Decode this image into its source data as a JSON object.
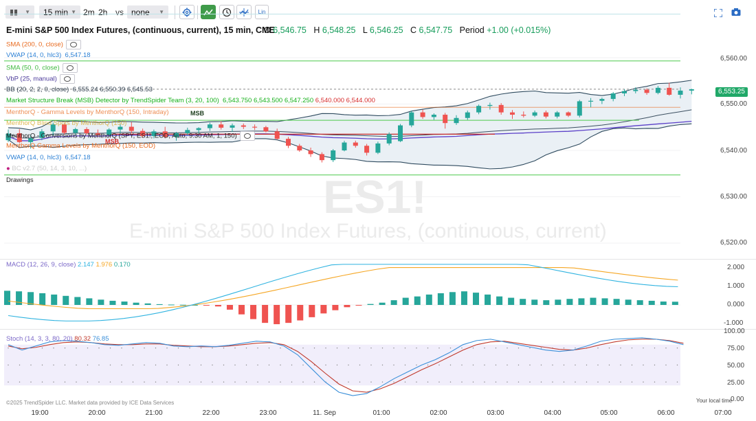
{
  "toolbar": {
    "chart_type_icon": "candles-icon",
    "interval": "15 min",
    "range_2m": "2m",
    "range_2h": "2h",
    "vs_label": "vs",
    "compare": "none",
    "settings_icon": "gear-icon",
    "crosshair_icon": "draw-cursor-icon",
    "clock_icon": "clock-icon",
    "trend_icon": "trendline-icon",
    "scale_label": "Lin",
    "fullscreen_icon": "fullscreen-icon",
    "camera_icon": "camera-icon"
  },
  "header": {
    "title": "E-mini S&P 500 Index Futures, (continuous, current), 15 min, CME",
    "o_label": "O",
    "o_value": "6,546.75",
    "h_label": "H",
    "h_value": "6,548.25",
    "l_label": "L",
    "l_value": "6,546.25",
    "c_label": "C",
    "c_value": "6,547.75",
    "period_label": "Period",
    "period_value": "+1.00 (+0.015%)"
  },
  "indicators": [
    {
      "label": "SMA (200, 0, close)",
      "color": "#e8691d"
    },
    {
      "label": "VWAP (14, 0, hlc3)",
      "color": "#2a7fd4",
      "value": "6,547.18"
    },
    {
      "label": "SMA (50, 0, close)",
      "color": "#3cb83c"
    },
    {
      "label": "VbP (25, manual)",
      "color": "#4b3a9a"
    },
    {
      "label": "BB (20, 2, 2, 0, close)",
      "color": "#2e3d4c",
      "values": "6,555.24  6,550.39  6,545.53"
    },
    {
      "label": "Market Structure Break (MSB) Detector by TrendSpider Team (3, 20, 100)",
      "color": "#15b01a",
      "values_green": "6,543.750  6,543.500  6,547.250",
      "values_red": "6,540.000  6,544.000"
    },
    {
      "label": "MenthorQ - Gamma Levels by MenthorQ (150, Intraday)",
      "color": "#e8691d"
    },
    {
      "label": "MenthorQ Blind Spots by MenthorQ (150)",
      "color": "#d4a017"
    },
    {
      "label": "MenthorQ - Conversions by MenthorQ (SPY, ES1!, EOD, Auto, 9:30 AM, 1, 150)",
      "color": "#222222"
    },
    {
      "label": "MenthorQ Gamma Levels by MenthorQ (150, EOD)",
      "color": "#e8691d"
    },
    {
      "label": "VWAP (14, 0, hlc3)",
      "color": "#2a7fd4",
      "value": "6,547.18"
    },
    {
      "label": "BC v2.7 (50, 14, 3, 10, ...)",
      "color": "#ccc"
    },
    {
      "label": "Drawings",
      "color": "#222222"
    }
  ],
  "price_axis": [
    "6,560.00",
    "6,550.00",
    "6,540.00",
    "6,530.00",
    "6,520.00"
  ],
  "last_price": "6,553.25",
  "watermark": {
    "symbol": "ES1!",
    "name": "E-mini S&P 500 Index Futures, (continuous, current)"
  },
  "msb_labels": [
    "MSB",
    "MSB"
  ],
  "macd": {
    "label": "MACD (12, 26, 9, close)",
    "v1": "2.147",
    "v2": "1.976",
    "v3": "0.170",
    "axis": [
      "2.000",
      "1.000",
      "0.000",
      "-1.000"
    ]
  },
  "stoch": {
    "label": "Stoch (14, 3, 3, 80, 20)",
    "v1": "80.32",
    "v2": "76.85",
    "axis": [
      "100.00",
      "75.00",
      "50.00",
      "25.00",
      "0.00"
    ]
  },
  "time_axis": [
    "19:00",
    "20:00",
    "21:00",
    "22:00",
    "23:00",
    "11. Sep",
    "01:00",
    "02:00",
    "03:00",
    "04:00",
    "05:00",
    "06:00",
    "07:00"
  ],
  "footer": {
    "copyright": "©2025 TrendSpider LLC. Market data provided by ICE Data Services",
    "local_time": "Your local time"
  },
  "colors": {
    "up": "#26a69a",
    "down": "#ef5350",
    "bb": "#2e4a5e",
    "macd": "#2fb3e0",
    "signal": "#f5a623",
    "stoch_k": "#3a8fd9",
    "stoch_d": "#c0392b"
  },
  "chart_data": {
    "type": "candlestick",
    "candles": [
      [
        6542.2,
        6544.5,
        6541.8,
        6543.6
      ],
      [
        6543.7,
        6544.6,
        6541.6,
        6541.8
      ],
      [
        6541.8,
        6543.4,
        6540.4,
        6542.6
      ],
      [
        6542.7,
        6544.6,
        6542.2,
        6544.1
      ],
      [
        6544.1,
        6546.0,
        6543.2,
        6545.6
      ],
      [
        6545.6,
        6545.9,
        6543.5,
        6543.8
      ],
      [
        6543.8,
        6544.9,
        6543.3,
        6544.6
      ],
      [
        6544.6,
        6545.0,
        6543.3,
        6543.7
      ],
      [
        6543.7,
        6544.5,
        6542.9,
        6543.3
      ],
      [
        6543.3,
        6544.8,
        6542.9,
        6544.5
      ],
      [
        6544.5,
        6545.7,
        6543.7,
        6545.1
      ],
      [
        6545.1,
        6546.1,
        6543.7,
        6544.2
      ],
      [
        6544.2,
        6544.7,
        6542.8,
        6543.1
      ],
      [
        6543.1,
        6544.5,
        6542.6,
        6544.1
      ],
      [
        6544.1,
        6545.1,
        6542.6,
        6542.9
      ],
      [
        6542.9,
        6544.0,
        6542.1,
        6543.7
      ],
      [
        6543.7,
        6544.9,
        6543.2,
        6544.4
      ],
      [
        6544.4,
        6545.0,
        6543.6,
        6544.8
      ],
      [
        6544.8,
        6546.0,
        6544.2,
        6545.6
      ],
      [
        6545.6,
        6546.3,
        6544.5,
        6544.9
      ],
      [
        6544.9,
        6545.8,
        6544.0,
        6545.4
      ],
      [
        6545.4,
        6545.8,
        6544.6,
        6545.1
      ],
      [
        6545.1,
        6545.6,
        6544.4,
        6545.0
      ],
      [
        6545.0,
        6545.3,
        6543.9,
        6544.1
      ],
      [
        6544.1,
        6544.7,
        6542.3,
        6542.5
      ],
      [
        6542.5,
        6542.9,
        6540.5,
        6541.0
      ],
      [
        6541.0,
        6541.4,
        6539.7,
        6540.0
      ],
      [
        6540.0,
        6540.6,
        6538.6,
        6539.2
      ],
      [
        6539.2,
        6539.6,
        6537.4,
        6537.9
      ],
      [
        6537.9,
        6540.3,
        6537.5,
        6540.0
      ],
      [
        6540.0,
        6542.1,
        6539.8,
        6541.7
      ],
      [
        6541.7,
        6542.1,
        6540.6,
        6541.0
      ],
      [
        6541.0,
        6541.4,
        6538.9,
        6539.5
      ],
      [
        6539.5,
        6541.9,
        6539.2,
        6541.5
      ],
      [
        6541.5,
        6543.9,
        6541.1,
        6543.5
      ],
      [
        6542.0,
        6545.7,
        6541.8,
        6545.4
      ],
      [
        6545.4,
        6548.6,
        6545.0,
        6548.2
      ],
      [
        6548.2,
        6548.8,
        6546.8,
        6547.2
      ],
      [
        6547.2,
        6548.0,
        6546.6,
        6547.7
      ],
      [
        6547.7,
        6548.1,
        6544.7,
        6545.9
      ],
      [
        6545.9,
        6547.6,
        6545.5,
        6547.0
      ],
      [
        6547.0,
        6548.6,
        6546.6,
        6548.2
      ],
      [
        6548.2,
        6549.9,
        6547.8,
        6549.6
      ],
      [
        6549.6,
        6550.3,
        6548.8,
        6549.8
      ],
      [
        6549.8,
        6550.2,
        6547.7,
        6548.2
      ],
      [
        6548.2,
        6548.7,
        6546.8,
        6547.7
      ],
      [
        6547.7,
        6548.4,
        6547.1,
        6547.5
      ],
      [
        6547.5,
        6548.6,
        6547.2,
        6548.2
      ],
      [
        6548.2,
        6548.6,
        6546.9,
        6547.3
      ],
      [
        6547.3,
        6548.5,
        6546.9,
        6548.2
      ],
      [
        6548.2,
        6548.4,
        6547.2,
        6547.5
      ],
      [
        6547.5,
        6550.9,
        6547.1,
        6550.6
      ],
      [
        6550.6,
        6551.3,
        6549.3,
        6550.7
      ],
      [
        6550.7,
        6551.4,
        6550.0,
        6551.1
      ],
      [
        6551.1,
        6552.6,
        6550.6,
        6552.3
      ],
      [
        6552.3,
        6553.2,
        6551.7,
        6552.8
      ],
      [
        6552.8,
        6553.6,
        6552.3,
        6553.1
      ],
      [
        6553.1,
        6553.4,
        6552.0,
        6552.4
      ],
      [
        6552.4,
        6553.9,
        6552.1,
        6553.5
      ],
      [
        6553.5,
        6554.6,
        6551.8,
        6552.0
      ],
      [
        6552.0,
        6553.6,
        6551.2,
        6552.9
      ],
      [
        6552.9,
        6553.3,
        6552.1,
        6553.2
      ]
    ],
    "overlays": [
      "BB (20, 2, 2, 0, close)",
      "SMA (50, 0, close)",
      "VWAP (14, 0, hlc3)",
      "SMA (200, 0, close)"
    ],
    "macd_hist": [
      0.75,
      0.72,
      0.68,
      0.62,
      0.55,
      0.48,
      0.42,
      0.35,
      0.28,
      0.22,
      0.18,
      0.12,
      0.08,
      0.04,
      0.02,
      0.01,
      0.0,
      -0.02,
      -0.08,
      -0.25,
      -0.5,
      -0.75,
      -0.95,
      -1.02,
      -0.95,
      -0.82,
      -0.65,
      -0.45,
      -0.28,
      -0.12,
      -0.02,
      0.05,
      0.12,
      0.25,
      0.38,
      0.45,
      0.55,
      0.62,
      0.68,
      0.72,
      0.65,
      0.55,
      0.45,
      0.38,
      0.32,
      0.28,
      0.25,
      0.28,
      0.32,
      0.35,
      0.38,
      0.35,
      0.32,
      0.28,
      0.25,
      0.22,
      0.18,
      0.17
    ],
    "stoch_range": [
      0,
      100
    ],
    "ylim": [
      6516,
      6563
    ]
  }
}
